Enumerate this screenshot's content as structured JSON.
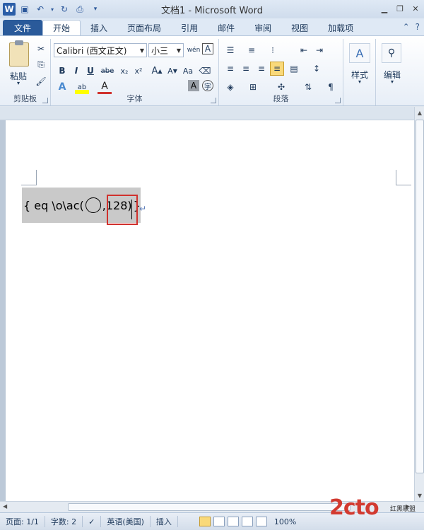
{
  "window": {
    "title": "文档1 - Microsoft Word"
  },
  "qat": {
    "logo": "W"
  },
  "tabs": [
    {
      "label": "文件"
    },
    {
      "label": "开始"
    },
    {
      "label": "插入"
    },
    {
      "label": "页面布局"
    },
    {
      "label": "引用"
    },
    {
      "label": "邮件"
    },
    {
      "label": "审阅"
    },
    {
      "label": "视图"
    },
    {
      "label": "加载项"
    }
  ],
  "ribbon": {
    "clipboard": {
      "label": "剪贴板",
      "paste": "粘贴"
    },
    "font": {
      "label": "字体",
      "font_name": "Calibri (西文正文)",
      "font_size": "小三",
      "bold": "B",
      "italic": "I",
      "underline": "U",
      "strike": "abe",
      "sub": "x₂",
      "sup": "x²",
      "grow": "A",
      "shrink": "A",
      "case": "Aa",
      "phonetic": "wén",
      "border_char": "A",
      "char_shade": "A",
      "enclose": "字"
    },
    "paragraph": {
      "label": "段落"
    },
    "styles": {
      "label": "样式"
    },
    "editing": {
      "label": "编辑"
    }
  },
  "document": {
    "field_prefix": "{ eq \\o\\ac(",
    "field_suffix": ",128)",
    "field_close": "}",
    "pilcrow": "↵"
  },
  "status": {
    "page": "页面: 1/1",
    "words": "字数: 2",
    "language": "英语(美国)",
    "mode": "插入",
    "zoom": "100%"
  },
  "watermark": {
    "main": "2cto",
    "sub": "红黑联盟"
  }
}
